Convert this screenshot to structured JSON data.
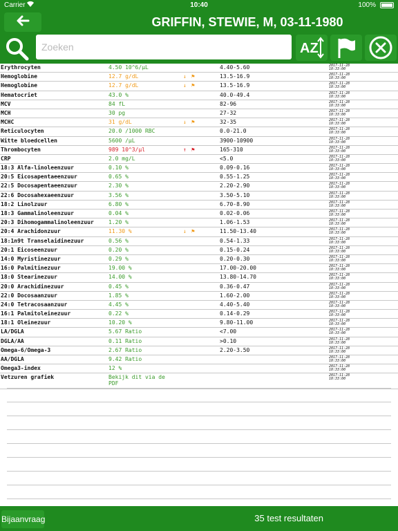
{
  "status": {
    "carrier": "Carrier",
    "time": "10:40",
    "battery": "100%"
  },
  "header": {
    "title": "GRIFFIN, STEWIE, M, 03-11-1980"
  },
  "search": {
    "placeholder": "Zoeken"
  },
  "toolbar": {
    "sort_label": "AZ"
  },
  "footer": {
    "button": "Bijaanvraag",
    "count": "35 test resultaten"
  },
  "colors": {
    "green_bar": "#1f8a1f",
    "value_green": "#3a9a2a",
    "value_orange": "#f09a18",
    "value_red": "#d8202a"
  },
  "results": [
    {
      "name": "Erythrocyten",
      "value": "4.50 10^6/µL",
      "status": "normal",
      "arrow": "",
      "flag": "",
      "ref": "4.40-5.60",
      "date": "2017-11-28",
      "time": "10:33:00"
    },
    {
      "name": "Hemoglobine",
      "value": "12.7 g/dL",
      "status": "low",
      "arrow": "↓",
      "flag": "⚑",
      "ref": "13.5-16.9",
      "date": "2017-11-28",
      "time": "10:33:00"
    },
    {
      "name": "Hemoglobine",
      "value": "12.7 g/dL",
      "status": "low",
      "arrow": "↓",
      "flag": "⚑",
      "ref": "13.5-16.9",
      "date": "2017-11-28",
      "time": "10:33:00"
    },
    {
      "name": "Hematocriet",
      "value": "43.0 %",
      "status": "normal",
      "arrow": "",
      "flag": "",
      "ref": "40.0-49.4",
      "date": "2017-11-28",
      "time": "10:33:00"
    },
    {
      "name": "MCV",
      "value": "84 fL",
      "status": "normal",
      "arrow": "",
      "flag": "",
      "ref": "82-96",
      "date": "2017-11-28",
      "time": "10:33:00"
    },
    {
      "name": "MCH",
      "value": "30 pg",
      "status": "normal",
      "arrow": "",
      "flag": "",
      "ref": "27-32",
      "date": "2017-11-28",
      "time": "10:33:00"
    },
    {
      "name": "MCHC",
      "value": "31 g/dL",
      "status": "low",
      "arrow": "↓",
      "flag": "⚑",
      "ref": "32-35",
      "date": "2017-11-28",
      "time": "10:33:00"
    },
    {
      "name": "Reticulocyten",
      "value": "20.0 /1000 RBC",
      "status": "normal",
      "arrow": "",
      "flag": "",
      "ref": "0.0-21.0",
      "date": "2017-11-28",
      "time": "10:33:00"
    },
    {
      "name": "Witte bloedcellen",
      "value": "5600 /µL",
      "status": "normal",
      "arrow": "",
      "flag": "",
      "ref": "3900-10900",
      "date": "2017-11-28",
      "time": "10:33:00"
    },
    {
      "name": "Thrombocyten",
      "value": "989 10^3/µl",
      "status": "high",
      "arrow": "↑",
      "flag": "⚑",
      "ref": "165-310",
      "date": "2017-11-28",
      "time": "10:33:00"
    },
    {
      "name": "CRP",
      "value": "2.0 mg/L",
      "status": "normal",
      "arrow": "",
      "flag": "",
      "ref": "<5.0",
      "date": "2017-11-28",
      "time": "10:33:00"
    },
    {
      "name": "18:3 Alfa-linoleenzuur",
      "value": "0.10 %",
      "status": "normal",
      "arrow": "",
      "flag": "",
      "ref": "0.09-0.16",
      "date": "2017-11-28",
      "time": "10:33:00"
    },
    {
      "name": "20:5 Eicosapentaeenzuur",
      "value": "0.65 %",
      "status": "normal",
      "arrow": "",
      "flag": "",
      "ref": "0.55-1.25",
      "date": "2017-11-28",
      "time": "10:33:00"
    },
    {
      "name": "22:5 Docosapentaeenzuur",
      "value": "2.30 %",
      "status": "normal",
      "arrow": "",
      "flag": "",
      "ref": "2.20-2.90",
      "date": "2017-11-28",
      "time": "10:33:00"
    },
    {
      "name": "22:6 Docosahexaeenzuur",
      "value": "3.56 %",
      "status": "normal",
      "arrow": "",
      "flag": "",
      "ref": "3.50-5.10",
      "date": "2017-11-28",
      "time": "10:33:00"
    },
    {
      "name": "18:2 Linolzuur",
      "value": "6.80 %",
      "status": "normal",
      "arrow": "",
      "flag": "",
      "ref": "6.70-8.90",
      "date": "2017-11-28",
      "time": "10:33:00"
    },
    {
      "name": "18:3 Gammalinoleenzuur",
      "value": "0.04 %",
      "status": "normal",
      "arrow": "",
      "flag": "",
      "ref": "0.02-0.06",
      "date": "2017-11-28",
      "time": "10:33:00"
    },
    {
      "name": "20:3 Dihomogammalinoleenzuur",
      "value": "1.20 %",
      "status": "normal",
      "arrow": "",
      "flag": "",
      "ref": "1.06-1.53",
      "date": "2017-11-28",
      "time": "10:33:00"
    },
    {
      "name": "20:4 Arachidonzuur",
      "value": "11.30 %",
      "status": "low",
      "arrow": "↓",
      "flag": "⚑",
      "ref": "11.50-13.40",
      "date": "2017-11-28",
      "time": "10:33:00"
    },
    {
      "name": "18:1n9t Transelaidinezuur",
      "value": "0.56 %",
      "status": "normal",
      "arrow": "",
      "flag": "",
      "ref": "0.54-1.33",
      "date": "2017-11-28",
      "time": "10:33:00"
    },
    {
      "name": "20:1 Eicoseenzuur",
      "value": "0.20 %",
      "status": "normal",
      "arrow": "",
      "flag": "",
      "ref": "0.15-0.24",
      "date": "2017-11-28",
      "time": "10:33:00"
    },
    {
      "name": "14:0 Myristinezuur",
      "value": "0.29 %",
      "status": "normal",
      "arrow": "",
      "flag": "",
      "ref": "0.20-0.30",
      "date": "2017-11-28",
      "time": "10:33:00"
    },
    {
      "name": "16:0 Palmitinezuur",
      "value": "19.00 %",
      "status": "normal",
      "arrow": "",
      "flag": "",
      "ref": "17.00-20.00",
      "date": "2017-11-28",
      "time": "10:33:00"
    },
    {
      "name": "18:0 Stearinezuur",
      "value": "14.00 %",
      "status": "normal",
      "arrow": "",
      "flag": "",
      "ref": "13.80-14.70",
      "date": "2017-11-28",
      "time": "10:33:00"
    },
    {
      "name": "20:0 Arachidinezuur",
      "value": "0.45 %",
      "status": "normal",
      "arrow": "",
      "flag": "",
      "ref": "0.36-0.47",
      "date": "2017-11-28",
      "time": "10:33:00"
    },
    {
      "name": "22:0 Docosaanzuur",
      "value": "1.85 %",
      "status": "normal",
      "arrow": "",
      "flag": "",
      "ref": "1.60-2.00",
      "date": "2017-11-28",
      "time": "10:33:00"
    },
    {
      "name": "24:0 Tetracosaanzuur",
      "value": "4.45 %",
      "status": "normal",
      "arrow": "",
      "flag": "",
      "ref": "4.40-5.40",
      "date": "2017-11-28",
      "time": "10:33:00"
    },
    {
      "name": "16:1 Palmitoleinezuur",
      "value": "0.22 %",
      "status": "normal",
      "arrow": "",
      "flag": "",
      "ref": "0.14-0.29",
      "date": "2017-11-28",
      "time": "10:33:00"
    },
    {
      "name": "18:1 Oleinezuur",
      "value": "10.20 %",
      "status": "normal",
      "arrow": "",
      "flag": "",
      "ref": "9.80-11.00",
      "date": "2017-11-28",
      "time": "10:33:00"
    },
    {
      "name": "LA/DGLA",
      "value": "5.67 Ratio",
      "status": "normal",
      "arrow": "",
      "flag": "",
      "ref": "<7.00",
      "date": "2017-11-28",
      "time": "10:33:00"
    },
    {
      "name": "DGLA/AA",
      "value": "0.11 Ratio",
      "status": "normal",
      "arrow": "",
      "flag": "",
      "ref": ">0.10",
      "date": "2017-11-28",
      "time": "10:33:00"
    },
    {
      "name": "Omega-6/Omega-3",
      "value": "2.67 Ratio",
      "status": "normal",
      "arrow": "",
      "flag": "",
      "ref": "2.20-3.50",
      "date": "2017-11-28",
      "time": "10:33:00"
    },
    {
      "name": "AA/DGLA",
      "value": "9.42 Ratio",
      "status": "normal",
      "arrow": "",
      "flag": "",
      "ref": "",
      "date": "2017-11-28",
      "time": "10:33:00"
    },
    {
      "name": "Omega3-index",
      "value": "12 %",
      "status": "normal",
      "arrow": "",
      "flag": "",
      "ref": "",
      "date": "2017-11-28",
      "time": "10:33:00"
    },
    {
      "name": "Vetzuren grafiek",
      "value": "Bekijk dit via de PDF",
      "status": "normal",
      "arrow": "",
      "flag": "",
      "ref": "",
      "date": "2017-11-28",
      "time": "10:33:00",
      "tall": true
    }
  ]
}
